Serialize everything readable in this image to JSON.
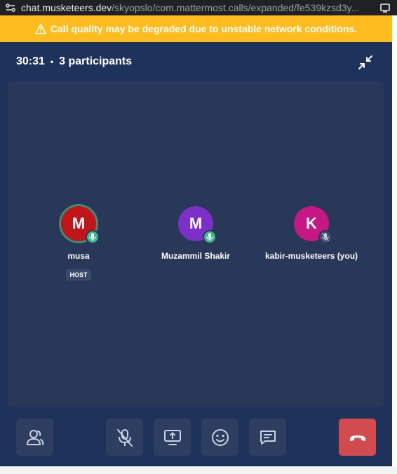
{
  "browser": {
    "host": "chat.musketeers.dev",
    "path": "/skyopslo/com.mattermost.calls/expanded/fe539kzsd3y..."
  },
  "banner": {
    "text": "Call quality may be degraded due to unstable network conditions.",
    "color": "#ffbc1f"
  },
  "call": {
    "timer": "30:31",
    "separator": "•",
    "participants_count": "3 participants"
  },
  "participants": [
    {
      "initial": "M",
      "name": "musa",
      "badge": "HOST",
      "avatar_color": "#c0161b",
      "mic": "on",
      "speaking": true
    },
    {
      "initial": "M",
      "name": "Muzammil Shakir",
      "avatar_color": "#7d30c8",
      "mic": "on",
      "speaking": false
    },
    {
      "initial": "K",
      "name": "kabir-musketeers (you)",
      "avatar_color": "#c71785",
      "mic": "off",
      "speaking": false
    }
  ],
  "controls": [
    {
      "name": "participants-list-button",
      "icon": "participants-icon"
    },
    {
      "name": "mute-button",
      "icon": "microphone-off-icon"
    },
    {
      "name": "share-screen-button",
      "icon": "screen-share-icon"
    },
    {
      "name": "reactions-button",
      "icon": "emoji-icon"
    },
    {
      "name": "chat-thread-button",
      "icon": "chat-icon"
    },
    {
      "name": "leave-call-button",
      "icon": "phone-hangup-icon"
    }
  ],
  "colors": {
    "window_bg": "#1e325c",
    "stage_bg": "#293859",
    "control_bg": "#2e3e60",
    "leave_bg": "#d24b4e",
    "mic_on": "#3db887"
  }
}
